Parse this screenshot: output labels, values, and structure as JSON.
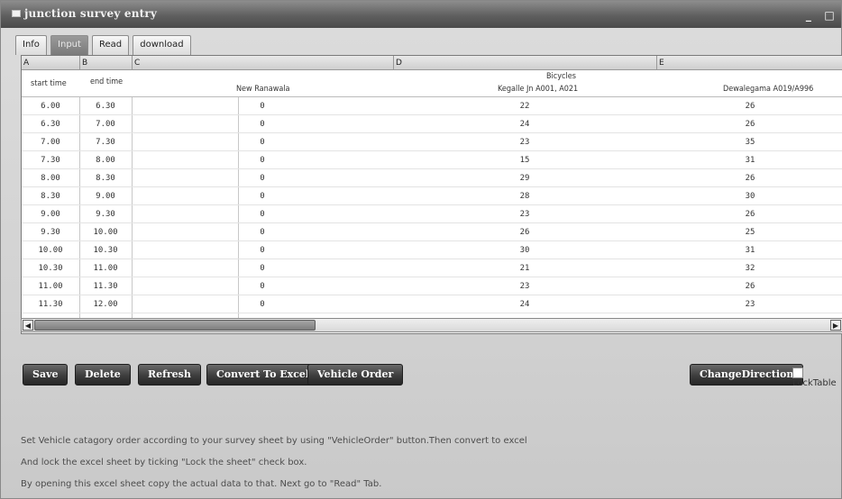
{
  "window": {
    "title": "junction survey entry",
    "minimize": "_",
    "restore": "□"
  },
  "tabs": [
    "Info",
    "Input",
    "Read",
    "download"
  ],
  "sheet": {
    "column_letters": [
      "A",
      "B",
      "C",
      "D",
      "E"
    ],
    "group_header": "Bicycles",
    "headers": {
      "start_time": "start time",
      "end_time": "end time",
      "c": "New Ranawala",
      "d": "Kegalle Jn A001, A021",
      "e": "Dewalegama A019/A996"
    },
    "rows": [
      [
        "6.00",
        "6.30",
        "0",
        "22",
        "26"
      ],
      [
        "6.30",
        "7.00",
        "0",
        "24",
        "26"
      ],
      [
        "7.00",
        "7.30",
        "0",
        "23",
        "35"
      ],
      [
        "7.30",
        "8.00",
        "0",
        "15",
        "31"
      ],
      [
        "8.00",
        "8.30",
        "0",
        "29",
        "26"
      ],
      [
        "8.30",
        "9.00",
        "0",
        "28",
        "30"
      ],
      [
        "9.00",
        "9.30",
        "0",
        "23",
        "26"
      ],
      [
        "9.30",
        "10.00",
        "0",
        "26",
        "25"
      ],
      [
        "10.00",
        "10.30",
        "0",
        "30",
        "31"
      ],
      [
        "10.30",
        "11.00",
        "0",
        "21",
        "32"
      ],
      [
        "11.00",
        "11.30",
        "0",
        "23",
        "26"
      ],
      [
        "11.30",
        "12.00",
        "0",
        "24",
        "23"
      ]
    ]
  },
  "buttons": {
    "save": "Save",
    "delete": "Delete",
    "refresh": "Refresh",
    "convert": "Convert To Excel",
    "vehicle_order": "Vehicle Order",
    "change_direction": "ChangeDirection"
  },
  "lock_table": {
    "label": "LockTable",
    "checked": false
  },
  "help": [
    "Set Vehicle catagory order according to your survey sheet by using \"VehicleOrder\" button.Then convert to excel",
    "And lock the excel sheet by ticking \"Lock the sheet\" check box.",
    "By opening this excel sheet copy the actual data to that. Next go to \"Read\" Tab."
  ]
}
